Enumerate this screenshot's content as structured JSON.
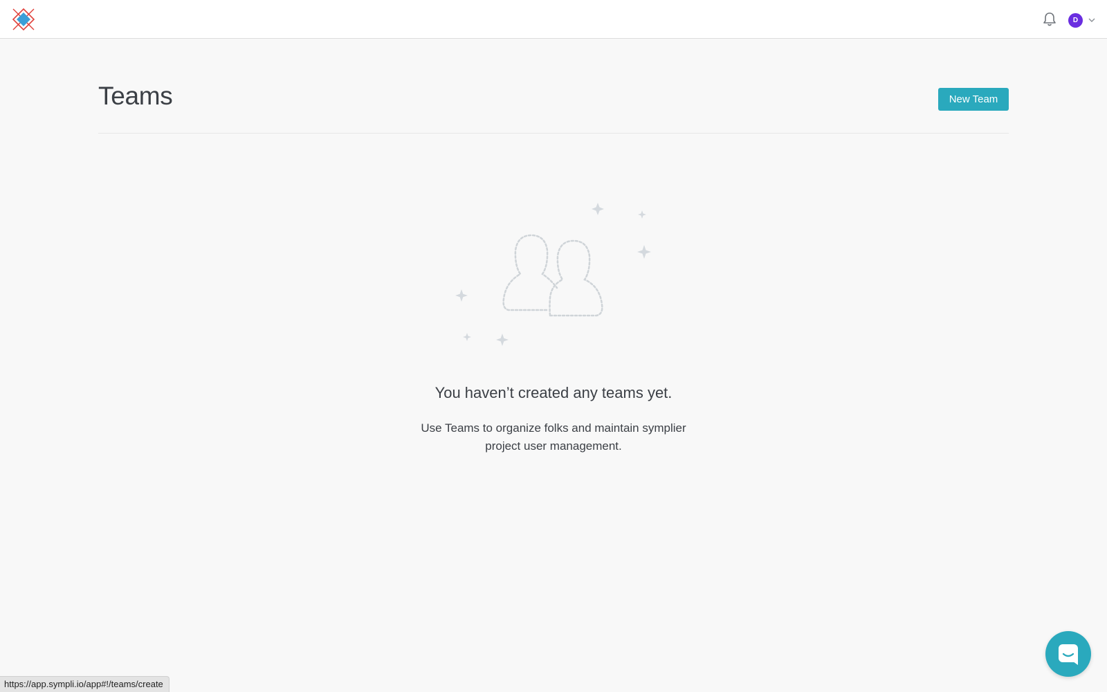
{
  "header": {
    "logo_icon": "sympli-diamond-logo-icon",
    "bell_icon": "bell-icon",
    "avatar_initial": "D",
    "avatar_color": "#6a2ee0",
    "chevron_icon": "chevron-down-icon"
  },
  "main": {
    "title": "Teams",
    "new_team_label": "New Team",
    "accent_color": "#2aa9bd",
    "empty_state": {
      "illustration_icon": "team-placeholder-icon",
      "title": "You haven’t created any teams yet.",
      "description": "Use Teams to organize folks and maintain symplier project user management."
    }
  },
  "status_bar": {
    "url": "https://app.sympli.io/app#!/teams/create"
  },
  "chat_widget": {
    "icon": "chat-icon",
    "color": "#2aa9bd"
  }
}
